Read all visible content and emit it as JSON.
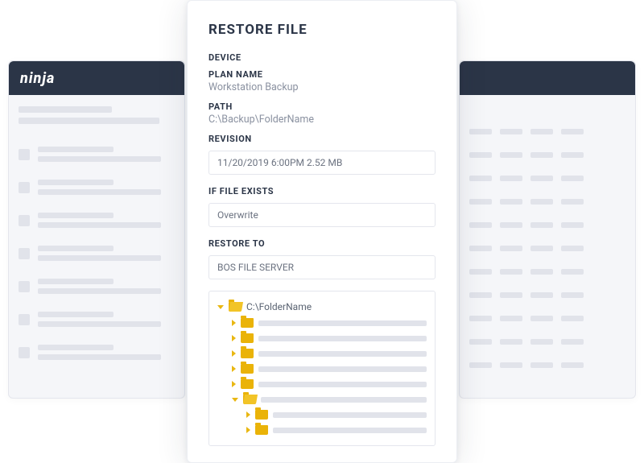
{
  "logo": "ninja",
  "dialog": {
    "title": "RESTORE FILE",
    "device_label": "DEVICE",
    "plan_label": "PLAN NAME",
    "plan_value": "Workstation Backup",
    "path_label": "PATH",
    "path_value": "C:\\Backup\\FolderName",
    "revision_label": "REVISION",
    "revision_value": "11/20/2019 6:00PM 2.52 MB",
    "exists_label": "IF FILE EXISTS",
    "exists_value": "Overwrite",
    "restore_label": "RESTORE TO",
    "restore_value": "BOS FILE SERVER",
    "tree_root": "C:\\FolderName"
  }
}
